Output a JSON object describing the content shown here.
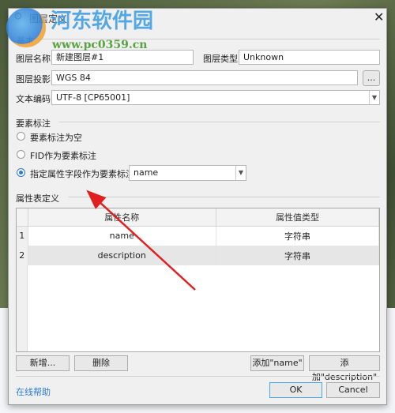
{
  "dialog": {
    "title": "图层定义",
    "close": "✕"
  },
  "basic": {
    "group": "基本",
    "name_label": "图层名称",
    "name_value": "新建图层#1",
    "type_label": "图层类型",
    "type_value": "Unknown",
    "proj_label": "图层投影",
    "proj_value": "WGS 84",
    "proj_button": "...",
    "enc_label": "文本编码",
    "enc_value": "UTF-8 [CP65001]"
  },
  "label": {
    "group": "要素标注",
    "options": [
      "要素标注为空",
      "FID作为要素标注",
      "指定属性字段作为要素标注"
    ],
    "selected": 2,
    "field_value": "name"
  },
  "attrs": {
    "group": "属性表定义",
    "columns": [
      "属性名称",
      "属性值类型"
    ],
    "rows": [
      {
        "n": "1",
        "name": "name",
        "type": "字符串"
      },
      {
        "n": "2",
        "name": "description",
        "type": "字符串"
      }
    ],
    "add": "新增...",
    "delete": "删除",
    "add_name": "添加\"name\"",
    "add_desc": "添加\"description\""
  },
  "footer": {
    "help": "在线帮助",
    "ok": "OK",
    "cancel": "Cancel"
  },
  "watermark": {
    "text": "河东软件园",
    "url": "www.pc0359.cn"
  },
  "colors": {
    "accent": "#2a7bd4",
    "arrow": "#e02020"
  }
}
